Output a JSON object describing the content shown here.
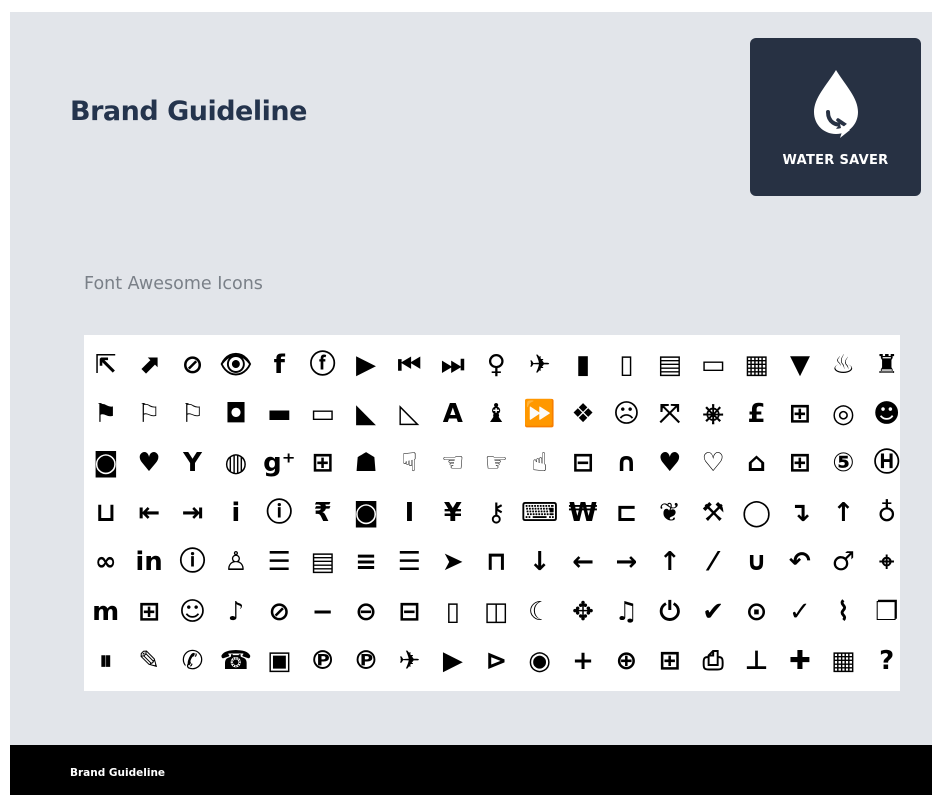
{
  "header": {
    "title": "Brand Guideline"
  },
  "logo": {
    "text": "WATER SAVER",
    "background": "#273143"
  },
  "section": {
    "subtitle": "Font Awesome Icons"
  },
  "footer": {
    "text": "Brand Guideline"
  },
  "icons": [
    {
      "name": "external-link-icon",
      "glyph": "⇱"
    },
    {
      "name": "external-link-square-icon",
      "glyph": "⬈"
    },
    {
      "name": "eye-slash-icon",
      "glyph": "⊘"
    },
    {
      "name": "eye-icon",
      "glyph": "👁"
    },
    {
      "name": "facebook-icon",
      "glyph": "f"
    },
    {
      "name": "facebook-square-icon",
      "glyph": "ⓕ"
    },
    {
      "name": "video-camera-icon",
      "glyph": "▶"
    },
    {
      "name": "fast-backward-icon",
      "glyph": "⏮"
    },
    {
      "name": "fast-forward-icon",
      "glyph": "⏭"
    },
    {
      "name": "female-icon",
      "glyph": "♀"
    },
    {
      "name": "fighter-jet-icon",
      "glyph": "✈"
    },
    {
      "name": "file-icon",
      "glyph": "▮"
    },
    {
      "name": "file-outline-icon",
      "glyph": "▯"
    },
    {
      "name": "file-text-icon",
      "glyph": "▤"
    },
    {
      "name": "file-text-outline-icon",
      "glyph": "▭"
    },
    {
      "name": "film-icon",
      "glyph": "▦"
    },
    {
      "name": "filter-icon",
      "glyph": "▼"
    },
    {
      "name": "fire-icon",
      "glyph": "♨"
    },
    {
      "name": "fire-extinguisher-icon",
      "glyph": "♜"
    },
    {
      "name": "flag-icon",
      "glyph": "⚑"
    },
    {
      "name": "flag-outline-icon",
      "glyph": "⚐"
    },
    {
      "name": "flag-checkered-icon",
      "glyph": "⚐"
    },
    {
      "name": "flickr-icon",
      "glyph": "◘"
    },
    {
      "name": "folder-icon",
      "glyph": "▬"
    },
    {
      "name": "folder-outline-icon",
      "glyph": "▭"
    },
    {
      "name": "folder-open-icon",
      "glyph": "◣"
    },
    {
      "name": "folder-open-outline-icon",
      "glyph": "◺"
    },
    {
      "name": "font-icon",
      "glyph": "A"
    },
    {
      "name": "foursquare-icon",
      "glyph": "♝"
    },
    {
      "name": "forward-icon",
      "glyph": "⏩"
    },
    {
      "name": "gittip-icon",
      "glyph": "❖"
    },
    {
      "name": "frown-icon",
      "glyph": "☹"
    },
    {
      "name": "arrows-alt-icon",
      "glyph": "⤧"
    },
    {
      "name": "gamepad-icon",
      "glyph": "⎈"
    },
    {
      "name": "gbp-icon",
      "glyph": "£"
    },
    {
      "name": "gift-icon",
      "glyph": "⊞"
    },
    {
      "name": "github-alt-icon",
      "glyph": "◎"
    },
    {
      "name": "github-cat-icon",
      "glyph": "☻"
    },
    {
      "name": "github-square-icon",
      "glyph": "◙"
    },
    {
      "name": "gittip-heart-icon",
      "glyph": "♥"
    },
    {
      "name": "glass-icon",
      "glyph": "Y"
    },
    {
      "name": "globe-icon",
      "glyph": "◍"
    },
    {
      "name": "google-plus-icon",
      "glyph": "g⁺"
    },
    {
      "name": "google-plus-square-icon",
      "glyph": "⊞"
    },
    {
      "name": "group-icon",
      "glyph": "☗"
    },
    {
      "name": "hand-down-icon",
      "glyph": "☟"
    },
    {
      "name": "hand-left-icon",
      "glyph": "☜"
    },
    {
      "name": "hand-right-icon",
      "glyph": "☞"
    },
    {
      "name": "hand-up-icon",
      "glyph": "☝"
    },
    {
      "name": "hdd-icon",
      "glyph": "⊟"
    },
    {
      "name": "headphones-icon",
      "glyph": "∩"
    },
    {
      "name": "heart-icon",
      "glyph": "♥"
    },
    {
      "name": "heart-outline-icon",
      "glyph": "♡"
    },
    {
      "name": "home-icon",
      "glyph": "⌂"
    },
    {
      "name": "hospital-icon",
      "glyph": "⊞"
    },
    {
      "name": "html5-icon",
      "glyph": "⑤"
    },
    {
      "name": "h-square-icon",
      "glyph": "Ⓗ"
    },
    {
      "name": "inbox-icon",
      "glyph": "⊔"
    },
    {
      "name": "outdent-icon",
      "glyph": "⇤"
    },
    {
      "name": "indent-icon",
      "glyph": "⇥"
    },
    {
      "name": "info-icon",
      "glyph": "i"
    },
    {
      "name": "info-circle-icon",
      "glyph": "ⓘ"
    },
    {
      "name": "inr-icon",
      "glyph": "₹"
    },
    {
      "name": "instagram-icon",
      "glyph": "◙"
    },
    {
      "name": "italic-icon",
      "glyph": "I"
    },
    {
      "name": "jpy-icon",
      "glyph": "¥"
    },
    {
      "name": "key-icon",
      "glyph": "⚷"
    },
    {
      "name": "keyboard-icon",
      "glyph": "⌨"
    },
    {
      "name": "krw-icon",
      "glyph": "₩"
    },
    {
      "name": "laptop-icon",
      "glyph": "⊏"
    },
    {
      "name": "leaf-icon",
      "glyph": "❦"
    },
    {
      "name": "legal-icon",
      "glyph": "⚒"
    },
    {
      "name": "lemon-icon",
      "glyph": "◯"
    },
    {
      "name": "level-down-icon",
      "glyph": "↴"
    },
    {
      "name": "level-up-icon",
      "glyph": "↑"
    },
    {
      "name": "lightbulb-icon",
      "glyph": "♁"
    },
    {
      "name": "link-icon",
      "glyph": "∞"
    },
    {
      "name": "linkedin-icon",
      "glyph": "in"
    },
    {
      "name": "linkedin-square-icon",
      "glyph": "ⓘ"
    },
    {
      "name": "linux-icon",
      "glyph": "♙"
    },
    {
      "name": "list-icon",
      "glyph": "☰"
    },
    {
      "name": "list-alt-icon",
      "glyph": "▤"
    },
    {
      "name": "list-ol-icon",
      "glyph": "≡"
    },
    {
      "name": "list-ul-icon",
      "glyph": "☰"
    },
    {
      "name": "location-arrow-icon",
      "glyph": "➤"
    },
    {
      "name": "lock-icon",
      "glyph": "⊓"
    },
    {
      "name": "long-arrow-down-icon",
      "glyph": "↓"
    },
    {
      "name": "long-arrow-left-icon",
      "glyph": "←"
    },
    {
      "name": "long-arrow-right-icon",
      "glyph": "→"
    },
    {
      "name": "long-arrow-up-icon",
      "glyph": "↑"
    },
    {
      "name": "magic-icon",
      "glyph": "⁄"
    },
    {
      "name": "magnet-icon",
      "glyph": "∪"
    },
    {
      "name": "reply-all-icon",
      "glyph": "↶"
    },
    {
      "name": "male-icon",
      "glyph": "♂"
    },
    {
      "name": "map-marker-icon",
      "glyph": "⌖"
    },
    {
      "name": "maxcdn-icon",
      "glyph": "m"
    },
    {
      "name": "medkit-icon",
      "glyph": "⊞"
    },
    {
      "name": "meh-icon",
      "glyph": "☺"
    },
    {
      "name": "microphone-icon",
      "glyph": "♪"
    },
    {
      "name": "microphone-slash-icon",
      "glyph": "⊘"
    },
    {
      "name": "minus-icon",
      "glyph": "−"
    },
    {
      "name": "minus-circle-icon",
      "glyph": "⊖"
    },
    {
      "name": "minus-square-icon",
      "glyph": "⊟"
    },
    {
      "name": "mobile-icon",
      "glyph": "▯"
    },
    {
      "name": "money-icon",
      "glyph": "◫"
    },
    {
      "name": "moon-icon",
      "glyph": "☾"
    },
    {
      "name": "arrows-icon",
      "glyph": "✥"
    },
    {
      "name": "music-icon",
      "glyph": "♫"
    },
    {
      "name": "power-off-icon",
      "glyph": "⏻"
    },
    {
      "name": "check-icon",
      "glyph": "✔"
    },
    {
      "name": "check-circle-outline-icon",
      "glyph": "⊙"
    },
    {
      "name": "check-circle-icon",
      "glyph": "✓"
    },
    {
      "name": "paperclip-icon",
      "glyph": "⌇"
    },
    {
      "name": "paste-icon",
      "glyph": "❐"
    },
    {
      "name": "pause-icon",
      "glyph": "⏸"
    },
    {
      "name": "pencil-icon",
      "glyph": "✎"
    },
    {
      "name": "phone-icon",
      "glyph": "✆"
    },
    {
      "name": "phone-square-icon",
      "glyph": "☎"
    },
    {
      "name": "picture-icon",
      "glyph": "▣"
    },
    {
      "name": "pinterest-icon",
      "glyph": "℗"
    },
    {
      "name": "pinterest-square-icon",
      "glyph": "℗"
    },
    {
      "name": "plane-icon",
      "glyph": "✈"
    },
    {
      "name": "play-icon",
      "glyph": "▶"
    },
    {
      "name": "play-circle-outline-icon",
      "glyph": "⊳"
    },
    {
      "name": "play-circle-icon",
      "glyph": "◉"
    },
    {
      "name": "plus-icon",
      "glyph": "+"
    },
    {
      "name": "plus-circle-icon",
      "glyph": "⊕"
    },
    {
      "name": "plus-square-icon",
      "glyph": "⊞"
    },
    {
      "name": "print-icon",
      "glyph": "⎙"
    },
    {
      "name": "thumb-tack-icon",
      "glyph": "⊥"
    },
    {
      "name": "puzzle-piece-icon",
      "glyph": "✚"
    },
    {
      "name": "qrcode-icon",
      "glyph": "▦"
    },
    {
      "name": "question-icon",
      "glyph": "?"
    }
  ]
}
